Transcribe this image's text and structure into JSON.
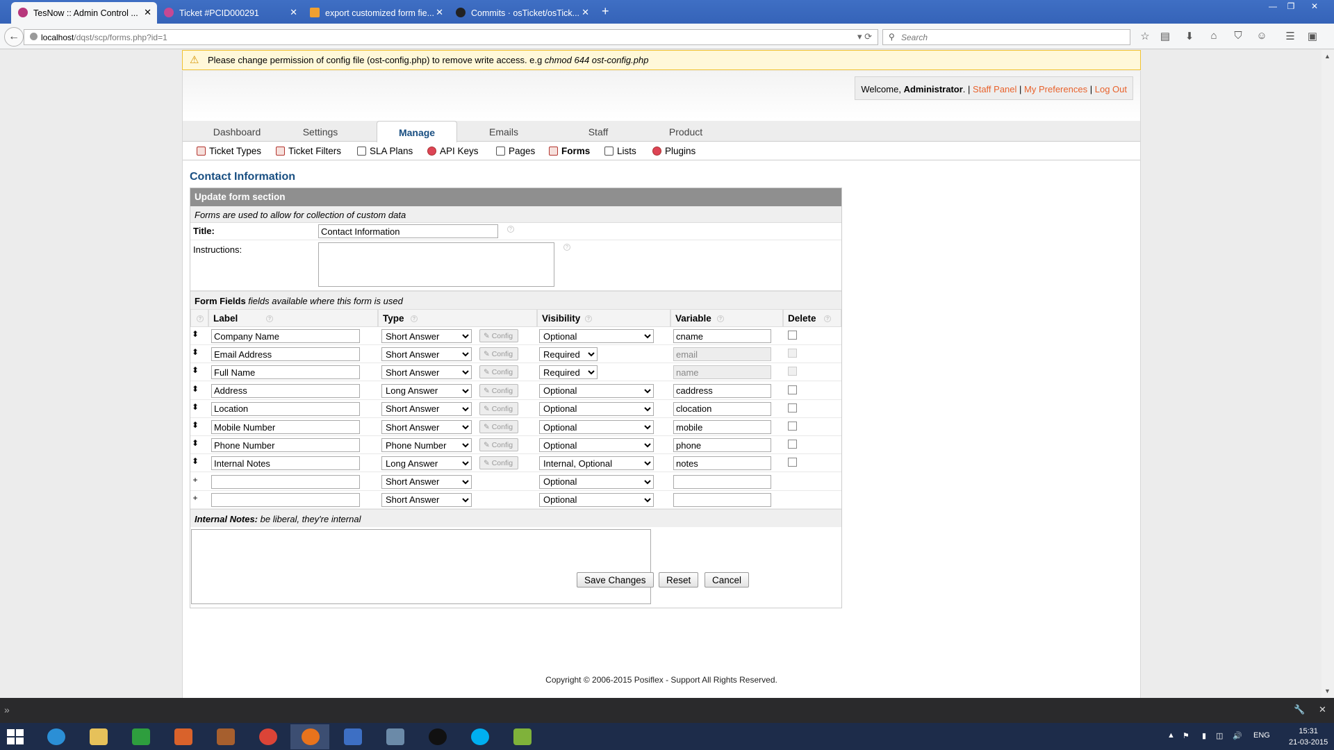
{
  "browser": {
    "tabs": [
      {
        "title": "TesNow :: Admin Control ...",
        "active": true,
        "color": "#b7377c"
      },
      {
        "title": "Ticket #PCID000291",
        "active": false,
        "color": "#b7377c"
      },
      {
        "title": "export customized form fie...",
        "active": false,
        "color": "#f0a030"
      },
      {
        "title": "Commits · osTicket/osTick...",
        "active": false,
        "color": "#222222"
      }
    ],
    "new_tab": "+",
    "url_host": "localhost",
    "url_path": "/dqst/scp/forms.php?id=1",
    "search_placeholder": "Search"
  },
  "warning": {
    "text": "Please change permission of config file (ost-config.php) to remove write access. e.g ",
    "command": "chmod 644 ost-config.php"
  },
  "userinfo": {
    "welcome": "Welcome, ",
    "user": "Administrator",
    "sep": ". |",
    "staff_panel": "Staff Panel",
    "pipe": "|",
    "preferences": "My Preferences",
    "logout": "Log Out"
  },
  "nav": {
    "tabs": [
      "Dashboard",
      "Settings",
      "Manage",
      "Emails",
      "Staff",
      "Product"
    ],
    "active": "Manage"
  },
  "subnav": [
    "Ticket Types",
    "Ticket Filters",
    "SLA Plans",
    "API Keys",
    "Pages",
    "Forms",
    "Lists",
    "Plugins"
  ],
  "page_title": "Contact Information",
  "form": {
    "section_title": "Update form section",
    "section_desc": "Forms are used to allow for collection of custom data",
    "title_label": "Title:",
    "title_value": "Contact Information",
    "instructions_label": "Instructions:",
    "fields_head_bold": "Form Fields",
    "fields_head_rest": " fields available where this form is used",
    "columns": {
      "label": "Label",
      "type": "Type",
      "visibility": "Visibility",
      "variable": "Variable",
      "delete": "Delete"
    },
    "config_label": "Config",
    "fields": [
      {
        "label": "Company Name",
        "type": "Short Answer",
        "visibility": "Optional",
        "variable": "cname",
        "locked": false,
        "new": false
      },
      {
        "label": "Email Address",
        "type": "Short Answer",
        "visibility": "Required",
        "variable": "email",
        "locked": true,
        "new": false
      },
      {
        "label": "Full Name",
        "type": "Short Answer",
        "visibility": "Required",
        "variable": "name",
        "locked": true,
        "new": false
      },
      {
        "label": "Address",
        "type": "Long Answer",
        "visibility": "Optional",
        "variable": "caddress",
        "locked": false,
        "new": false
      },
      {
        "label": "Location",
        "type": "Short Answer",
        "visibility": "Optional",
        "variable": "clocation",
        "locked": false,
        "new": false
      },
      {
        "label": "Mobile Number",
        "type": "Short Answer",
        "visibility": "Optional",
        "variable": "mobile",
        "locked": false,
        "new": false
      },
      {
        "label": "Phone Number",
        "type": "Phone Number",
        "visibility": "Optional",
        "variable": "phone",
        "locked": false,
        "new": false
      },
      {
        "label": "Internal Notes",
        "type": "Long Answer",
        "visibility": "Internal, Optional",
        "variable": "notes",
        "locked": false,
        "new": false
      },
      {
        "label": "",
        "type": "Short Answer",
        "visibility": "Optional",
        "variable": "",
        "locked": false,
        "new": true
      },
      {
        "label": "",
        "type": "Short Answer",
        "visibility": "Optional",
        "variable": "",
        "locked": false,
        "new": true
      }
    ],
    "notes_label": "Internal Notes:",
    "notes_hint": " be liberal, they're internal",
    "buttons": {
      "save": "Save Changes",
      "reset": "Reset",
      "cancel": "Cancel"
    }
  },
  "footer": "Copyright © 2006-2015 Posiflex - Support All Rights Reserved.",
  "taskbar": {
    "language": "ENG",
    "time": "15:31",
    "date": "21-03-2015"
  }
}
